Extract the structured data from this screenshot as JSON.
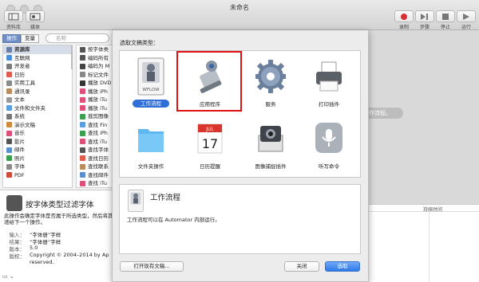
{
  "window": {
    "title": "未命名"
  },
  "toolbar": {
    "library_label": "资料库",
    "media_label": "媒体",
    "record_label": "录制",
    "step_label": "步骤",
    "stop_label": "停止",
    "run_label": "运行"
  },
  "sidebar": {
    "tabs": [
      {
        "label": "操作",
        "active": true
      },
      {
        "label": "变量",
        "active": false
      }
    ],
    "search_placeholder": "名称",
    "library_items": [
      {
        "label": "资源库",
        "color": "#6a7fa6"
      },
      {
        "label": "互联网",
        "color": "#4a8fd9"
      },
      {
        "label": "开发者",
        "color": "#7b7b7b"
      },
      {
        "label": "日历",
        "color": "#e25c4e"
      },
      {
        "label": "实用工具",
        "color": "#8a8a8a"
      },
      {
        "label": "通讯录",
        "color": "#b98c5a"
      },
      {
        "label": "文本",
        "color": "#9a9a9a"
      },
      {
        "label": "文件和文件夹",
        "color": "#5aa0e0"
      },
      {
        "label": "系统",
        "color": "#777777"
      },
      {
        "label": "演示文稿",
        "color": "#d08a3a"
      },
      {
        "label": "音乐",
        "color": "#e04f7a"
      },
      {
        "label": "影片",
        "color": "#555555"
      },
      {
        "label": "邮件",
        "color": "#5a8fd0"
      },
      {
        "label": "照片",
        "color": "#3aa04f"
      },
      {
        "label": "字体",
        "color": "#8b8b8b"
      },
      {
        "label": "PDF",
        "color": "#d24a3a"
      }
    ],
    "actions": [
      {
        "label": "按字体类",
        "color": "#555555"
      },
      {
        "label": "编码所有",
        "color": "#555555"
      },
      {
        "label": "编码为 M",
        "color": "#444444"
      },
      {
        "label": "标记文件",
        "color": "#888888"
      },
      {
        "label": "播放 DVD",
        "color": "#333333"
      },
      {
        "label": "播放 iPh",
        "color": "#e04f7a"
      },
      {
        "label": "播放 iTu",
        "color": "#e04f7a"
      },
      {
        "label": "播放 iTu",
        "color": "#e04f7a"
      },
      {
        "label": "裁剪图像",
        "color": "#3aa04f"
      },
      {
        "label": "查找 Fin",
        "color": "#5aa0e0"
      },
      {
        "label": "查找 iPh",
        "color": "#3aa04f"
      },
      {
        "label": "查找 iTu",
        "color": "#e04f7a"
      },
      {
        "label": "查找字体",
        "color": "#555555"
      },
      {
        "label": "查找日历",
        "color": "#e25c4e"
      },
      {
        "label": "查找联系",
        "color": "#b98c5a"
      },
      {
        "label": "查找邮件",
        "color": "#5a8fd0"
      },
      {
        "label": "查找 iTu",
        "color": "#e04f7a"
      }
    ]
  },
  "detail": {
    "title": "按字体类型过滤字体",
    "description": "此操作会确定字体是否属于所选类型，然后将其传递给下一个操作。",
    "fields": [
      {
        "key": "输入：",
        "value": "“字体册”字样"
      },
      {
        "key": "结果：",
        "value": "“字体册”字样"
      },
      {
        "key": "版本：",
        "value": "5.0"
      },
      {
        "key": "版权：",
        "value": "Copyright © 2004–2014 by Ap"
      },
      {
        "key": "",
        "value": "reserved."
      }
    ]
  },
  "sheet": {
    "prompt": "选取文稿类型：",
    "types": [
      {
        "label": "工作流程",
        "selected": true,
        "icon": "workflow-icon"
      },
      {
        "label": "应用程序",
        "selected": false,
        "icon": "application-robot-icon"
      },
      {
        "label": "服务",
        "selected": false,
        "icon": "service-gear-icon"
      },
      {
        "label": "打印插件",
        "selected": false,
        "icon": "printer-icon"
      },
      {
        "label": "文件夹操作",
        "selected": false,
        "icon": "folder-icon"
      },
      {
        "label": "日历提醒",
        "selected": false,
        "icon": "calendar-icon"
      },
      {
        "label": "图像捕捉插件",
        "selected": false,
        "icon": "image-capture-icon"
      },
      {
        "label": "听写命令",
        "selected": false,
        "icon": "microphone-icon"
      }
    ],
    "calendar_month": "JUL",
    "calendar_day": "17",
    "wflow_badge": "WFLOW",
    "desc_title": "工作流程",
    "desc_text": "工作流程可以在 Automator 内部运行。",
    "open_existing": "打开现有文稿...",
    "close_button": "关闭",
    "choose_button": "选取"
  },
  "canvas": {
    "hint": "作流程。",
    "log_column": "持续时间"
  }
}
